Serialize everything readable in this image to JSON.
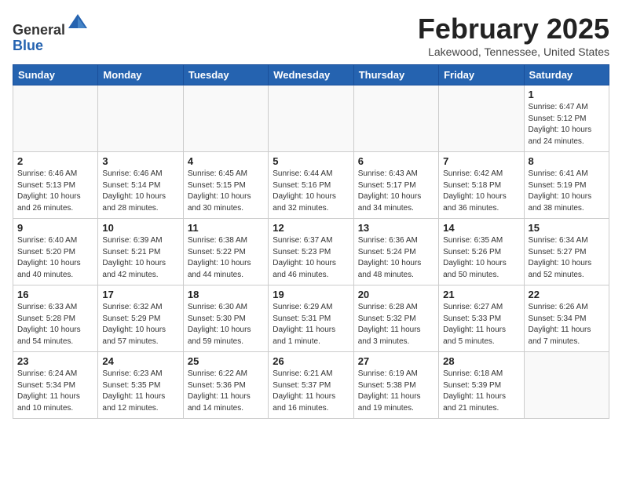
{
  "header": {
    "logo_line1": "General",
    "logo_line2": "Blue",
    "month_title": "February 2025",
    "location": "Lakewood, Tennessee, United States"
  },
  "columns": [
    "Sunday",
    "Monday",
    "Tuesday",
    "Wednesday",
    "Thursday",
    "Friday",
    "Saturday"
  ],
  "weeks": [
    [
      {
        "day": "",
        "info": ""
      },
      {
        "day": "",
        "info": ""
      },
      {
        "day": "",
        "info": ""
      },
      {
        "day": "",
        "info": ""
      },
      {
        "day": "",
        "info": ""
      },
      {
        "day": "",
        "info": ""
      },
      {
        "day": "1",
        "info": "Sunrise: 6:47 AM\nSunset: 5:12 PM\nDaylight: 10 hours\nand 24 minutes."
      }
    ],
    [
      {
        "day": "2",
        "info": "Sunrise: 6:46 AM\nSunset: 5:13 PM\nDaylight: 10 hours\nand 26 minutes."
      },
      {
        "day": "3",
        "info": "Sunrise: 6:46 AM\nSunset: 5:14 PM\nDaylight: 10 hours\nand 28 minutes."
      },
      {
        "day": "4",
        "info": "Sunrise: 6:45 AM\nSunset: 5:15 PM\nDaylight: 10 hours\nand 30 minutes."
      },
      {
        "day": "5",
        "info": "Sunrise: 6:44 AM\nSunset: 5:16 PM\nDaylight: 10 hours\nand 32 minutes."
      },
      {
        "day": "6",
        "info": "Sunrise: 6:43 AM\nSunset: 5:17 PM\nDaylight: 10 hours\nand 34 minutes."
      },
      {
        "day": "7",
        "info": "Sunrise: 6:42 AM\nSunset: 5:18 PM\nDaylight: 10 hours\nand 36 minutes."
      },
      {
        "day": "8",
        "info": "Sunrise: 6:41 AM\nSunset: 5:19 PM\nDaylight: 10 hours\nand 38 minutes."
      }
    ],
    [
      {
        "day": "9",
        "info": "Sunrise: 6:40 AM\nSunset: 5:20 PM\nDaylight: 10 hours\nand 40 minutes."
      },
      {
        "day": "10",
        "info": "Sunrise: 6:39 AM\nSunset: 5:21 PM\nDaylight: 10 hours\nand 42 minutes."
      },
      {
        "day": "11",
        "info": "Sunrise: 6:38 AM\nSunset: 5:22 PM\nDaylight: 10 hours\nand 44 minutes."
      },
      {
        "day": "12",
        "info": "Sunrise: 6:37 AM\nSunset: 5:23 PM\nDaylight: 10 hours\nand 46 minutes."
      },
      {
        "day": "13",
        "info": "Sunrise: 6:36 AM\nSunset: 5:24 PM\nDaylight: 10 hours\nand 48 minutes."
      },
      {
        "day": "14",
        "info": "Sunrise: 6:35 AM\nSunset: 5:26 PM\nDaylight: 10 hours\nand 50 minutes."
      },
      {
        "day": "15",
        "info": "Sunrise: 6:34 AM\nSunset: 5:27 PM\nDaylight: 10 hours\nand 52 minutes."
      }
    ],
    [
      {
        "day": "16",
        "info": "Sunrise: 6:33 AM\nSunset: 5:28 PM\nDaylight: 10 hours\nand 54 minutes."
      },
      {
        "day": "17",
        "info": "Sunrise: 6:32 AM\nSunset: 5:29 PM\nDaylight: 10 hours\nand 57 minutes."
      },
      {
        "day": "18",
        "info": "Sunrise: 6:30 AM\nSunset: 5:30 PM\nDaylight: 10 hours\nand 59 minutes."
      },
      {
        "day": "19",
        "info": "Sunrise: 6:29 AM\nSunset: 5:31 PM\nDaylight: 11 hours\nand 1 minute."
      },
      {
        "day": "20",
        "info": "Sunrise: 6:28 AM\nSunset: 5:32 PM\nDaylight: 11 hours\nand 3 minutes."
      },
      {
        "day": "21",
        "info": "Sunrise: 6:27 AM\nSunset: 5:33 PM\nDaylight: 11 hours\nand 5 minutes."
      },
      {
        "day": "22",
        "info": "Sunrise: 6:26 AM\nSunset: 5:34 PM\nDaylight: 11 hours\nand 7 minutes."
      }
    ],
    [
      {
        "day": "23",
        "info": "Sunrise: 6:24 AM\nSunset: 5:34 PM\nDaylight: 11 hours\nand 10 minutes."
      },
      {
        "day": "24",
        "info": "Sunrise: 6:23 AM\nSunset: 5:35 PM\nDaylight: 11 hours\nand 12 minutes."
      },
      {
        "day": "25",
        "info": "Sunrise: 6:22 AM\nSunset: 5:36 PM\nDaylight: 11 hours\nand 14 minutes."
      },
      {
        "day": "26",
        "info": "Sunrise: 6:21 AM\nSunset: 5:37 PM\nDaylight: 11 hours\nand 16 minutes."
      },
      {
        "day": "27",
        "info": "Sunrise: 6:19 AM\nSunset: 5:38 PM\nDaylight: 11 hours\nand 19 minutes."
      },
      {
        "day": "28",
        "info": "Sunrise: 6:18 AM\nSunset: 5:39 PM\nDaylight: 11 hours\nand 21 minutes."
      },
      {
        "day": "",
        "info": ""
      }
    ]
  ]
}
